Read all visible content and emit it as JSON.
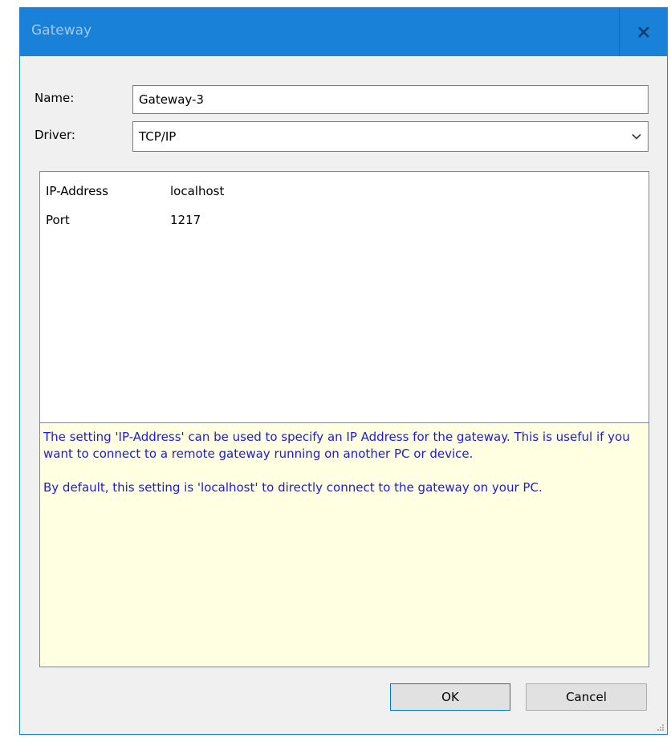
{
  "window": {
    "title": "Gateway",
    "close_icon": "close-icon"
  },
  "form": {
    "name_label": "Name:",
    "name_value": "Gateway-3",
    "driver_label": "Driver:",
    "driver_value": "TCP/IP",
    "driver_arrow_icon": "chevron-down-icon"
  },
  "properties": [
    {
      "name": "IP-Address",
      "value": "localhost"
    },
    {
      "name": "Port",
      "value": "1217"
    }
  ],
  "help": {
    "paragraph1": "The setting 'IP-Address' can be used to specify an IP Address for the gateway. This is useful if you want to connect to a remote gateway running on another PC or device.",
    "paragraph2": "By default, this setting is 'localhost' to directly connect to the gateway on your PC."
  },
  "buttons": {
    "ok_label": "OK",
    "cancel_label": "Cancel"
  },
  "colors": {
    "titlebar": "#1a81d8",
    "help_background": "#ffffe1",
    "help_text": "#1a1ae6"
  }
}
